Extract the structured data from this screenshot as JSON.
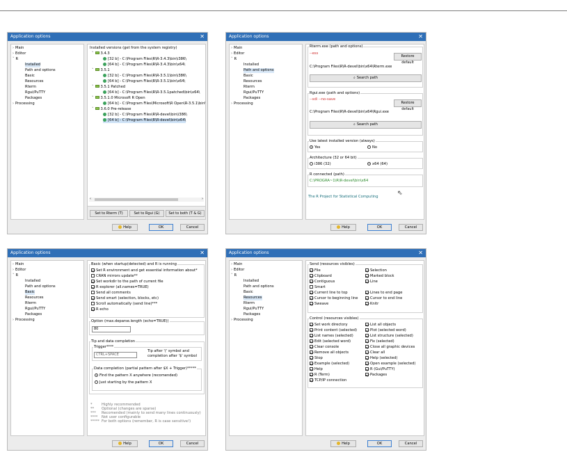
{
  "dialog": {
    "title": "Application options",
    "close_glyph": "✕",
    "help_label": "Help",
    "ok_label": "OK",
    "cancel_label": "Cancel"
  },
  "tree": {
    "main": "Main",
    "editor": "Editor",
    "r": "R",
    "installed": "Installed",
    "path_options": "Path and options",
    "basic": "Basic",
    "resources": "Resources",
    "rterm": "Rterm",
    "rgui_putty": "Rgui/PuTTY",
    "packages": "Packages",
    "processing": "Processing"
  },
  "installed": {
    "header": "Installed versions (get from the system registry)",
    "versions": [
      {
        "name": "3.4.3",
        "paths": [
          "[32 b] - C:\\Program Files\\R\\R-3.4.3\\bin\\i386\\",
          "[64 b] - C:\\Program Files\\R\\R-3.4.3\\bin\\x64\\"
        ]
      },
      {
        "name": "3.5.1",
        "paths": [
          "[32 b] - C:\\Program Files\\R\\R-3.5.1\\bin\\i386\\",
          "[64 b] - C:\\Program Files\\R\\R-3.5.1\\bin\\x64\\"
        ]
      },
      {
        "name": "3.5.1 Patched",
        "paths": [
          "[64 b] - C:\\Program Files\\R\\R-3.5.1patched\\bin\\x64\\"
        ]
      },
      {
        "name": "3.5.1.0 Microsoft R Open",
        "paths": [
          "[64 b] - C:\\Program Files\\Microsoft\\R Open\\R-3.5.1\\bin\\"
        ]
      },
      {
        "name": "3.6.0 Pre-release",
        "paths": [
          "[32 b] - C:\\Program Files\\R\\R-devel\\bin\\i386\\",
          "[64 b] - C:\\Program Files\\R\\R-devel\\bin\\x64\\"
        ]
      }
    ],
    "set_rterm": "Set to Rterm (T)",
    "set_rgui": "Set to Rgui (G)",
    "set_both": "Set to both (T & G)"
  },
  "paths": {
    "rterm_group": "Rterm.exe (path and options)",
    "rterm_opts": "--ess",
    "rterm_path": "C:\\Program Files\\R\\R-devel\\bin\\x64\\Rterm.exe",
    "restore_default": "Restore default",
    "search_path": "Search path",
    "rgui_group": "Rgui.exe (path and options)",
    "rgui_opts": "--sdi --no-save",
    "rgui_path": "C:\\Program Files\\R\\R-devel\\bin\\x64\\Rgui.exe",
    "latest_group": "Use latest installed version (always)",
    "yes": "Yes",
    "no": "No",
    "arch_group": "Architecture (32 or 64 bit)",
    "i386": "i386 (32)",
    "x64": "x64 (64)",
    "connected_group": "R connected (path)",
    "connected_path": "C:\\PROGRA~1\\R\\R-devel\\bin\\x64",
    "link": "The R Project for Statistical Computing"
  },
  "basic": {
    "group": "Basic (when startup(detected) and R is running",
    "items": [
      {
        "label": "Set R environment and get essential information about*",
        "checked": true
      },
      {
        "label": "CRAN mirrors update**",
        "checked": false
      },
      {
        "label": "Set workdir to the path of current file",
        "checked": true
      },
      {
        "label": "R explorer (all.names=TRUE)",
        "checked": true
      },
      {
        "label": "Send all comments",
        "checked": false
      },
      {
        "label": "Send smart (selection, blocks, etc)",
        "checked": true
      },
      {
        "label": "Scroll automatically (send line)***",
        "checked": false
      },
      {
        "label": "R echo",
        "checked": true
      }
    ],
    "option_label": "Option (max.deparse.length (echo=TRUE))",
    "option_value": "80",
    "tip_group": "Tip and data completion",
    "trigger_label": "Trigger****",
    "trigger_value": "CTRL+SPACE",
    "trigger_note1": "Tip after '(' symbol and",
    "trigger_note2": "completion after '$' symbol",
    "completion_group": "Data completion (partial pattern after $X + Trigger)*****",
    "find_anywhere": "Find the pattern X anywhere (recomended)",
    "just_starting": "Just starting by the pattern X",
    "notes": [
      {
        "mark": "*",
        "text": "Highly recommended"
      },
      {
        "mark": "**",
        "text": "Optional (changes are sparse)"
      },
      {
        "mark": "***",
        "text": "Recomended (mainly to send many lines continuously)"
      },
      {
        "mark": "****",
        "text": "Not user configurable"
      },
      {
        "mark": "*****",
        "text": "For both options (remember, R is case sensitive!)"
      }
    ]
  },
  "resources": {
    "send_group": "Send (resources visibles)",
    "send_left": [
      {
        "label": "File",
        "checked": true
      },
      {
        "label": "Clipboard",
        "checked": true
      },
      {
        "label": "Contiguous",
        "checked": true
      },
      {
        "label": "Smart",
        "checked": false
      },
      {
        "label": "Current line to top",
        "checked": true
      },
      {
        "label": "Cursor to beginning line",
        "checked": true
      },
      {
        "label": "Sweave",
        "checked": true
      }
    ],
    "send_right": [
      {
        "label": "Selection",
        "checked": true
      },
      {
        "label": "Marked block",
        "checked": true
      },
      {
        "label": "Line",
        "checked": true
      },
      {
        "label": "",
        "checked": false
      },
      {
        "label": "Lines to end page",
        "checked": true
      },
      {
        "label": "Cursor to end line",
        "checked": true
      },
      {
        "label": "Knitr",
        "checked": true
      }
    ],
    "control_group": "Control (resources visibles)",
    "control_left": [
      "Set work directory",
      "Print content (selected)",
      "List names (selected)",
      "Edit (selected word)",
      "Clear console",
      "Remove all objects",
      "Stop",
      "Example (selected)",
      "Help",
      "R (Term)",
      "TCP/IP connection"
    ],
    "control_right": [
      "List all objects",
      "Plot (selected word)",
      "List structure (selected)",
      "Fix (selected)",
      "Close all graphic devices",
      "Clear all",
      "Help (selected)",
      "Open example (selected)",
      "R (Gui/PuTTY)",
      "Packages"
    ]
  }
}
